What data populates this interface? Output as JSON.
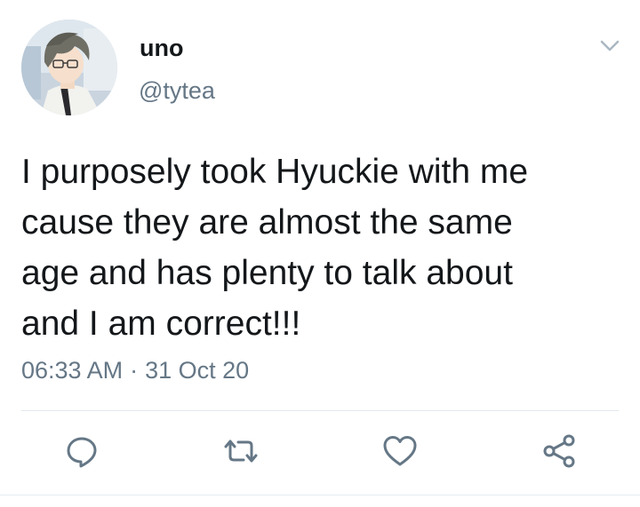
{
  "user": {
    "display_name": "uno",
    "handle": "@tytea",
    "avatar_icon": "avatar-anime-boy-glasses"
  },
  "tweet": {
    "text": "I purposely took Hyuckie with me\ncause they are almost the same\nage and has plenty to talk about\nand I am correct!!!",
    "time": "06:33 AM",
    "separator": "·",
    "date": "31 Oct 20"
  },
  "actions": [
    {
      "name": "reply",
      "icon": "reply-icon"
    },
    {
      "name": "retweet",
      "icon": "retweet-icon"
    },
    {
      "name": "like",
      "icon": "heart-icon"
    },
    {
      "name": "share",
      "icon": "share-icon"
    }
  ],
  "colors": {
    "text": "#14171a",
    "secondary": "#657786",
    "divider": "#e1e8ed",
    "icon": "#657786"
  }
}
